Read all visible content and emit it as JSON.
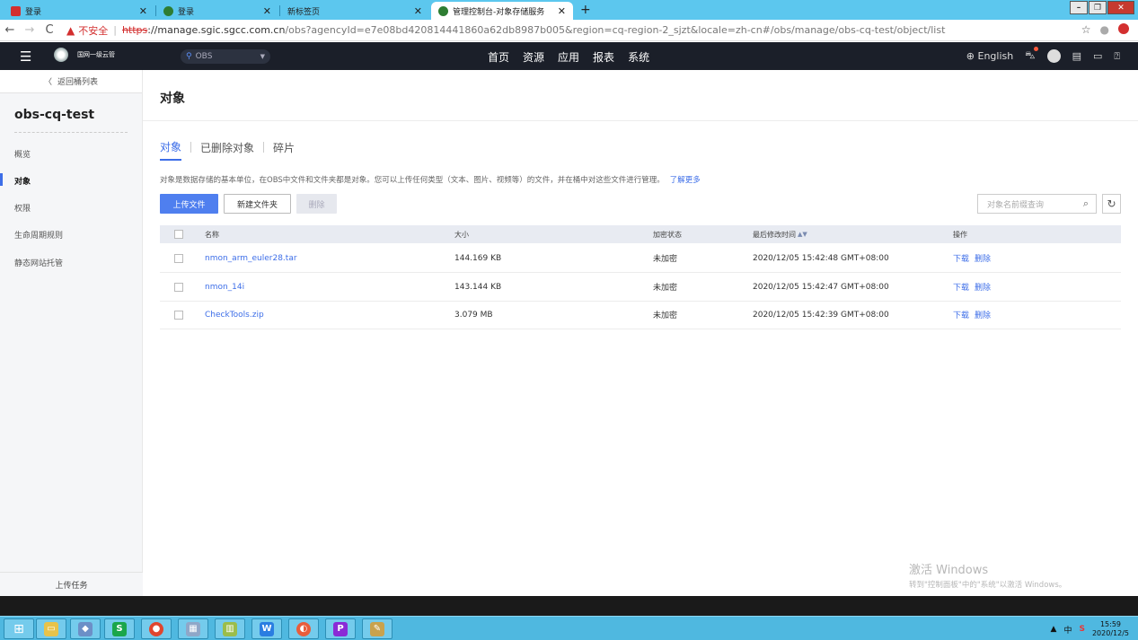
{
  "browser": {
    "tabs": [
      {
        "title": "登录",
        "favicon_color": "#d32f2f"
      },
      {
        "title": "登录",
        "favicon_color": "#2e7d32"
      },
      {
        "title": "新标签页",
        "favicon_color": ""
      },
      {
        "title": "管理控制台-对象存储服务",
        "favicon_color": "#2e7d32"
      }
    ],
    "security_warning": "不安全",
    "url_scheme": "https",
    "url_host": "://manage.sgic.sgcc.com.cn",
    "url_rest": "/obs?agencyId=e7e08bd420814441860a62db8987b005&region=cq-region-2_sjzt&locale=zh-cn#/obs/manage/obs-cq-test/object/list"
  },
  "topnav": {
    "logo_text": "国网一级云管",
    "region": "OBS",
    "menu": [
      "首页",
      "资源",
      "应用",
      "报表",
      "系统"
    ],
    "language": "English"
  },
  "sidebar": {
    "back_label": "返回桶列表",
    "bucket_name": "obs-cq-test",
    "items": [
      "概览",
      "对象",
      "权限",
      "生命周期规则",
      "静态网站托管"
    ],
    "active_index": 1,
    "upload_task": "上传任务"
  },
  "main": {
    "title": "对象",
    "tabs": [
      "对象",
      "已删除对象",
      "碎片"
    ],
    "description": "对象是数据存储的基本单位，在OBS中文件和文件夹都是对象。您可以上传任何类型（文本、图片、视频等）的文件，并在桶中对这些文件进行管理。",
    "learn_more": "了解更多",
    "buttons": {
      "upload": "上传文件",
      "new_folder": "新建文件夹",
      "delete": "删除"
    },
    "search_placeholder": "对象名前缀查询",
    "table": {
      "headers": {
        "name": "名称",
        "size": "大小",
        "encryption": "加密状态",
        "modified": "最后修改时间",
        "ops": "操作"
      },
      "rows": [
        {
          "name": "nmon_arm_euler28.tar",
          "size": "144.169 KB",
          "encryption": "未加密",
          "modified": "2020/12/05 15:42:48 GMT+08:00",
          "op1": "下载",
          "op2": "删除"
        },
        {
          "name": "nmon_14i",
          "size": "143.144 KB",
          "encryption": "未加密",
          "modified": "2020/12/05 15:42:47 GMT+08:00",
          "op1": "下载",
          "op2": "删除"
        },
        {
          "name": "CheckTools.zip",
          "size": "3.079 MB",
          "encryption": "未加密",
          "modified": "2020/12/05 15:42:39 GMT+08:00",
          "op1": "下载",
          "op2": "删除"
        }
      ]
    }
  },
  "watermark": {
    "line1": "激活 Windows",
    "line2": "转到\"控制面板\"中的\"系统\"以激活 Windows。"
  },
  "taskbar": {
    "ime": "中",
    "time": "15:59",
    "date": "2020/12/5"
  }
}
